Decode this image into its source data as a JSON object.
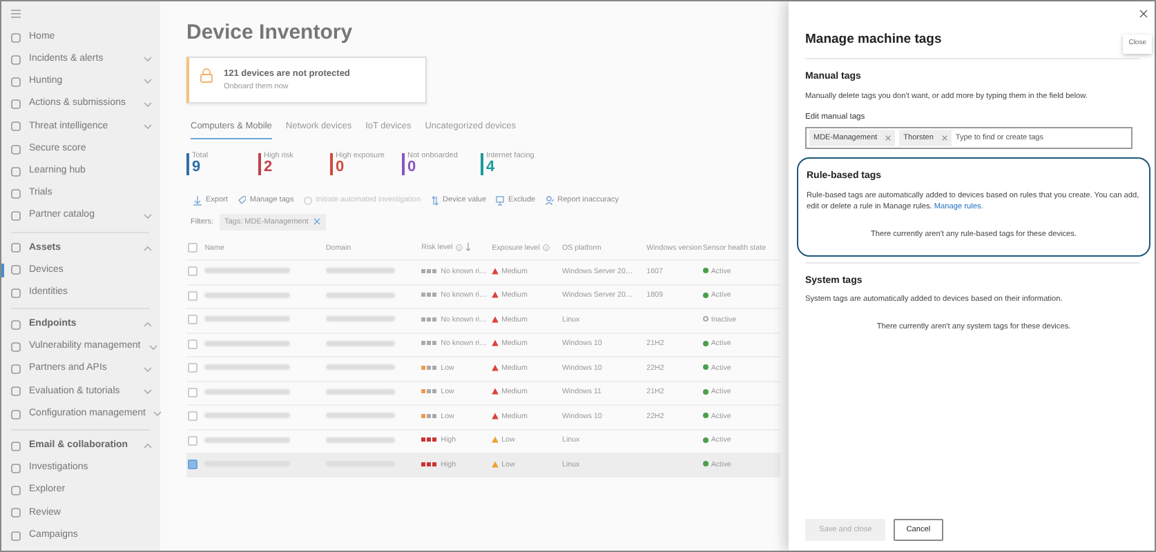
{
  "sidebar": {
    "items": [
      {
        "kind": "item",
        "label": "Home",
        "selected": false
      },
      {
        "kind": "item",
        "label": "Incidents & alerts",
        "expanded": false,
        "selected": false
      },
      {
        "kind": "item",
        "label": "Hunting",
        "expanded": false,
        "selected": false
      },
      {
        "kind": "item",
        "label": "Actions & submissions",
        "expanded": false,
        "selected": false
      },
      {
        "kind": "item",
        "label": "Threat intelligence",
        "expanded": false,
        "selected": false
      },
      {
        "kind": "item",
        "label": "Secure score",
        "selected": false
      },
      {
        "kind": "item",
        "label": "Learning hub",
        "selected": false
      },
      {
        "kind": "item",
        "label": "Trials",
        "selected": false
      },
      {
        "kind": "item",
        "label": "Partner catalog",
        "expanded": false,
        "selected": false
      },
      {
        "kind": "section",
        "label": "Assets",
        "expanded": true,
        "selected": false
      },
      {
        "kind": "item",
        "label": "Devices",
        "selected": true
      },
      {
        "kind": "item",
        "label": "Identities",
        "selected": false
      },
      {
        "kind": "section",
        "label": "Endpoints",
        "expanded": true,
        "selected": false
      },
      {
        "kind": "item",
        "label": "Vulnerability management",
        "expanded": false,
        "selected": false
      },
      {
        "kind": "item",
        "label": "Partners and APIs",
        "expanded": false,
        "selected": false
      },
      {
        "kind": "item",
        "label": "Evaluation & tutorials",
        "expanded": false,
        "selected": false
      },
      {
        "kind": "item",
        "label": "Configuration management",
        "expanded": false,
        "selected": false
      },
      {
        "kind": "section",
        "label": "Email & collaboration",
        "expanded": true,
        "selected": false
      },
      {
        "kind": "item",
        "label": "Investigations",
        "selected": false
      },
      {
        "kind": "item",
        "label": "Explorer",
        "selected": false
      },
      {
        "kind": "item",
        "label": "Review",
        "selected": false
      },
      {
        "kind": "item",
        "label": "Campaigns",
        "selected": false
      }
    ]
  },
  "main": {
    "title": "Device Inventory",
    "alert": {
      "title": "121 devices are not protected",
      "subtitle": "Onboard them now"
    },
    "tabs": [
      {
        "label": "Computers & Mobile",
        "selected": true
      },
      {
        "label": "Network devices",
        "selected": false
      },
      {
        "label": "IoT devices",
        "selected": false
      },
      {
        "label": "Uncategorized devices",
        "selected": false
      }
    ],
    "stats": [
      {
        "label": "Total",
        "value": "9",
        "color": "#2f6fa8"
      },
      {
        "label": "High risk",
        "value": "2",
        "color": "#c4404a"
      },
      {
        "label": "High exposure",
        "value": "0",
        "color": "#d24a3c"
      },
      {
        "label": "Not onboarded",
        "value": "0",
        "color": "#8a56c0"
      },
      {
        "label": "Internet facing",
        "value": "4",
        "color": "#1d9a9a"
      }
    ],
    "toolbar": [
      {
        "label": "Export",
        "disabled": false
      },
      {
        "label": "Manage tags",
        "disabled": false
      },
      {
        "label": "Initiate automated investigation",
        "disabled": true
      },
      {
        "label": "Device value",
        "disabled": false
      },
      {
        "label": "Exclude",
        "disabled": false
      },
      {
        "label": "Report inaccuracy",
        "disabled": false
      }
    ],
    "filters": {
      "label": "Filters:",
      "chips": [
        "Tags: MDE-Management"
      ]
    },
    "table": {
      "columns": [
        {
          "label": "Name"
        },
        {
          "label": "Domain"
        },
        {
          "label": "Risk level",
          "info": true,
          "sorted": true
        },
        {
          "label": "Exposure level",
          "info": true
        },
        {
          "label": "OS platform"
        },
        {
          "label": "Windows version"
        },
        {
          "label": "Sensor health state"
        }
      ],
      "all_selected": false,
      "rows": [
        {
          "selected": false,
          "risk": {
            "kind": "none",
            "text": "No known ri…"
          },
          "exposure": {
            "kind": "medium",
            "text": "Medium"
          },
          "os": "Windows Server 20…",
          "version": "1607",
          "sensor": {
            "active": true,
            "text": "Active"
          }
        },
        {
          "selected": false,
          "risk": {
            "kind": "none",
            "text": "No known ri…"
          },
          "exposure": {
            "kind": "medium",
            "text": "Medium"
          },
          "os": "Windows Server 20…",
          "version": "1809",
          "sensor": {
            "active": true,
            "text": "Active"
          }
        },
        {
          "selected": false,
          "risk": {
            "kind": "none",
            "text": "No known ri…"
          },
          "exposure": {
            "kind": "medium",
            "text": "Medium"
          },
          "os": "Linux",
          "sensor": {
            "active": false,
            "text": "Inactive"
          }
        },
        {
          "selected": false,
          "risk": {
            "kind": "none",
            "text": "No known ri…"
          },
          "exposure": {
            "kind": "medium",
            "text": "Medium"
          },
          "os": "Windows 10",
          "version": "21H2",
          "sensor": {
            "active": true,
            "text": "Active"
          }
        },
        {
          "selected": false,
          "risk": {
            "kind": "low",
            "text": "Low"
          },
          "exposure": {
            "kind": "medium",
            "text": "Medium"
          },
          "os": "Windows 10",
          "version": "22H2",
          "sensor": {
            "active": true,
            "text": "Active"
          }
        },
        {
          "selected": false,
          "risk": {
            "kind": "low",
            "text": "Low"
          },
          "exposure": {
            "kind": "medium",
            "text": "Medium"
          },
          "os": "Windows 11",
          "version": "21H2",
          "sensor": {
            "active": true,
            "text": "Active"
          }
        },
        {
          "selected": false,
          "risk": {
            "kind": "low",
            "text": "Low"
          },
          "exposure": {
            "kind": "medium",
            "text": "Medium"
          },
          "os": "Windows 10",
          "version": "22H2",
          "sensor": {
            "active": true,
            "text": "Active"
          }
        },
        {
          "selected": false,
          "risk": {
            "kind": "high",
            "text": "High"
          },
          "exposure": {
            "kind": "low",
            "text": "Low"
          },
          "os": "Linux",
          "sensor": {
            "active": true,
            "text": "Active"
          }
        },
        {
          "selected": true,
          "risk": {
            "kind": "high",
            "text": "High"
          },
          "exposure": {
            "kind": "low",
            "text": "Low"
          },
          "os": "Linux",
          "sensor": {
            "active": true,
            "text": "Active"
          }
        }
      ]
    }
  },
  "panel": {
    "title": "Manage machine tags",
    "close_tooltip": "Close",
    "sections": [
      {
        "kind": "manual",
        "title": "Manual tags",
        "description": "Manually delete tags you don't want, or add more by typing them in the field below.",
        "field_label": "Edit manual tags",
        "tags": [
          "MDE-Management",
          "Thorsten"
        ],
        "placeholder": "Type to find or create tags"
      },
      {
        "kind": "rule",
        "title": "Rule-based tags",
        "description": "Rule-based tags are automatically added to devices based on rules that you create. You can add, edit or delete a rule in Manage rules.",
        "link": "Manage rules.",
        "empty": "There currently aren't any rule-based tags for these devices.",
        "highlighted": true
      },
      {
        "kind": "system",
        "title": "System tags",
        "description": "System tags are automatically added to devices based on their information.",
        "empty": "There currently aren't any system tags for these devices."
      }
    ],
    "buttons": [
      {
        "label": "Save and close",
        "disabled": true
      },
      {
        "label": "Cancel",
        "disabled": false
      }
    ]
  }
}
